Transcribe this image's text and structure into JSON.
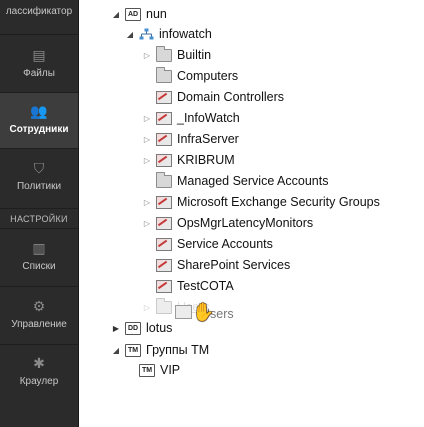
{
  "sidebar": {
    "items": [
      {
        "label": "лассификатор",
        "icon": "tag-icon",
        "active": false
      },
      {
        "label": "Файлы",
        "icon": "files-icon",
        "active": false
      },
      {
        "label": "Сотрудники",
        "icon": "people-icon",
        "active": true
      },
      {
        "label": "Политики",
        "icon": "shield-icon",
        "active": false
      },
      {
        "label": "Списки",
        "icon": "books-icon",
        "active": false
      },
      {
        "label": "Управление",
        "icon": "gears-icon",
        "active": false
      },
      {
        "label": "Краулер",
        "icon": "spider-icon",
        "active": false
      }
    ],
    "section_header": "НАСТРОЙКИ"
  },
  "tree": {
    "root": {
      "label": "nun",
      "badge": "AD"
    },
    "domain": {
      "label": "infowatch"
    },
    "children": [
      {
        "label": "Builtin",
        "icon": "folder-icon",
        "expandable": true
      },
      {
        "label": "Computers",
        "icon": "folder-icon",
        "expandable": false
      },
      {
        "label": "Domain Controllers",
        "icon": "ou-icon",
        "expandable": false
      },
      {
        "label": "_InfoWatch",
        "icon": "ou-icon",
        "expandable": true
      },
      {
        "label": "InfraServer",
        "icon": "ou-icon",
        "expandable": true
      },
      {
        "label": "KRIBRUM",
        "icon": "ou-icon",
        "expandable": true
      },
      {
        "label": "Managed Service Accounts",
        "icon": "folder-icon",
        "expandable": false
      },
      {
        "label": "Microsoft Exchange Security Groups",
        "icon": "ou-icon",
        "expandable": true
      },
      {
        "label": "OpsMgrLatencyMonitors",
        "icon": "ou-icon",
        "expandable": true
      },
      {
        "label": "Service Accounts",
        "icon": "ou-icon",
        "expandable": false
      },
      {
        "label": "SharePoint Services",
        "icon": "ou-icon",
        "expandable": false
      },
      {
        "label": "TestCOTA",
        "icon": "ou-icon",
        "expandable": false
      },
      {
        "label": "Users",
        "icon": "folder-icon",
        "expandable": true,
        "dragging": true
      }
    ],
    "drag_label": "Users",
    "lotus": {
      "label": "lotus",
      "badge": "DD"
    },
    "tm_groups": {
      "label": "Группы ТМ",
      "badge": "TM"
    },
    "vip": {
      "label": "VIP",
      "badge": "TM"
    }
  },
  "colors": {
    "sidebar_bg": "#2b2b2b",
    "active_bg": "#3d3d3d",
    "ou_accent": "#c43a3a"
  }
}
